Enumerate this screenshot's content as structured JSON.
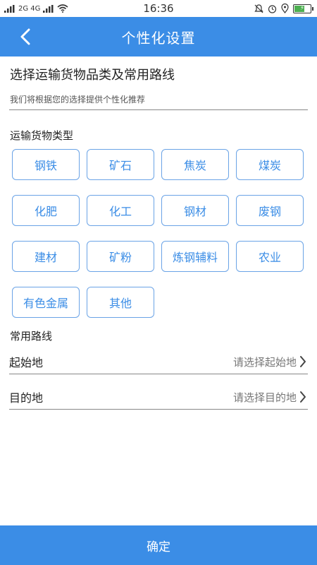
{
  "status_bar": {
    "time": "16:36",
    "signal_text": "2G 4G",
    "icons": [
      "signal-icon",
      "wifi-icon",
      "mute-icon",
      "alarm-icon",
      "location-icon",
      "battery-icon"
    ]
  },
  "header": {
    "title": "个性化设置",
    "back_icon": "chevron-left-icon",
    "background": "#3b8de6"
  },
  "intro": {
    "title": "选择运输货物品类及常用路线",
    "subtitle": "我们将根据您的选择提供个性化推荐"
  },
  "cargo": {
    "label": "运输货物类型",
    "types": [
      "钢铁",
      "矿石",
      "焦炭",
      "煤炭",
      "化肥",
      "化工",
      "钢材",
      "废钢",
      "建材",
      "矿粉",
      "炼钢辅料",
      "农业",
      "有色金属",
      "其他"
    ]
  },
  "routes": {
    "label": "常用路线",
    "origin": {
      "label": "起始地",
      "placeholder": "请选择起始地"
    },
    "destination": {
      "label": "目的地",
      "placeholder": "请选择目的地"
    }
  },
  "confirm_label": "确定",
  "colors": {
    "accent": "#3b8de6",
    "chip_border": "#6aa3e6"
  }
}
